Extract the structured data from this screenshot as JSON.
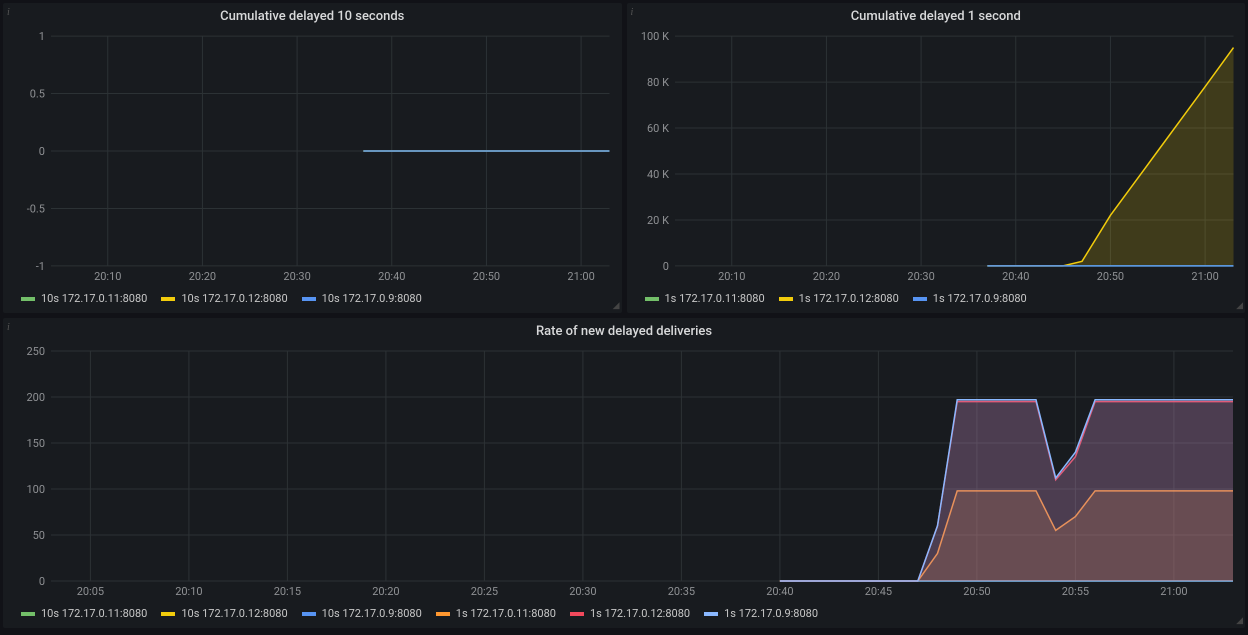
{
  "colors": {
    "green": "#73bf69",
    "yellow": "#f2cc0c",
    "cyan": "#5794f2",
    "orange": "#ff9830",
    "red": "#f2495c",
    "blue": "#8ab8ff"
  },
  "panels": {
    "p1": {
      "title": "Cumulative delayed 10 seconds",
      "legend": [
        {
          "label": "10s 172.17.0.11:8080",
          "color": "green"
        },
        {
          "label": "10s 172.17.0.12:8080",
          "color": "yellow"
        },
        {
          "label": "10s 172.17.0.9:8080",
          "color": "cyan"
        }
      ]
    },
    "p2": {
      "title": "Cumulative delayed 1 second",
      "legend": [
        {
          "label": "1s 172.17.0.11:8080",
          "color": "green"
        },
        {
          "label": "1s 172.17.0.12:8080",
          "color": "yellow"
        },
        {
          "label": "1s 172.17.0.9:8080",
          "color": "cyan"
        }
      ]
    },
    "p3": {
      "title": "Rate of new delayed deliveries",
      "legend": [
        {
          "label": "10s 172.17.0.11:8080",
          "color": "green"
        },
        {
          "label": "10s 172.17.0.12:8080",
          "color": "yellow"
        },
        {
          "label": "10s 172.17.0.9:8080",
          "color": "cyan"
        },
        {
          "label": "1s 172.17.0.11:8080",
          "color": "orange"
        },
        {
          "label": "1s 172.17.0.12:8080",
          "color": "red"
        },
        {
          "label": "1s 172.17.0.9:8080",
          "color": "blue"
        }
      ]
    }
  },
  "chart_data": [
    {
      "id": "p1",
      "type": "line",
      "title": "Cumulative delayed 10 seconds",
      "xlabel": "",
      "ylabel": "",
      "x_ticks": [
        "20:10",
        "20:20",
        "20:30",
        "20:40",
        "20:50",
        "21:00"
      ],
      "y_ticks": [
        -1.0,
        -0.5,
        0,
        0.5,
        1.0
      ],
      "xlim": [
        "20:04",
        "21:03"
      ],
      "ylim": [
        -1.0,
        1.0
      ],
      "series": [
        {
          "name": "10s 172.17.0.11:8080",
          "color": "green",
          "x": [
            "20:37",
            "21:03"
          ],
          "y": [
            0,
            0
          ]
        },
        {
          "name": "10s 172.17.0.12:8080",
          "color": "yellow",
          "x": [
            "20:37",
            "21:03"
          ],
          "y": [
            0,
            0
          ]
        },
        {
          "name": "10s 172.17.0.9:8080",
          "color": "cyan",
          "x": [
            "20:37",
            "21:03"
          ],
          "y": [
            0,
            0
          ]
        }
      ]
    },
    {
      "id": "p2",
      "type": "area",
      "title": "Cumulative delayed 1 second",
      "xlabel": "",
      "ylabel": "",
      "x_ticks": [
        "20:10",
        "20:20",
        "20:30",
        "20:40",
        "20:50",
        "21:00"
      ],
      "y_ticks_labels": [
        "0",
        "20 K",
        "40 K",
        "60 K",
        "80 K",
        "100 K"
      ],
      "y_ticks": [
        0,
        20000,
        40000,
        60000,
        80000,
        100000
      ],
      "xlim": [
        "20:04",
        "21:03"
      ],
      "ylim": [
        0,
        100000
      ],
      "series": [
        {
          "name": "1s 172.17.0.11:8080",
          "color": "green",
          "x": [
            "20:37",
            "20:45",
            "20:50",
            "20:55",
            "21:00",
            "21:03"
          ],
          "y": [
            0,
            0,
            0,
            0,
            0,
            0
          ]
        },
        {
          "name": "1s 172.17.0.12:8080",
          "color": "yellow",
          "x": [
            "20:37",
            "20:45",
            "20:47",
            "20:50",
            "20:55",
            "21:00",
            "21:03"
          ],
          "y": [
            0,
            0,
            2000,
            22000,
            50000,
            78000,
            95000
          ]
        },
        {
          "name": "1s 172.17.0.9:8080",
          "color": "cyan",
          "x": [
            "20:37",
            "20:45",
            "20:50",
            "20:55",
            "21:00",
            "21:03"
          ],
          "y": [
            0,
            0,
            0,
            0,
            0,
            0
          ]
        }
      ]
    },
    {
      "id": "p3",
      "type": "area",
      "title": "Rate of new delayed deliveries",
      "xlabel": "",
      "ylabel": "",
      "x_ticks": [
        "20:05",
        "20:10",
        "20:15",
        "20:20",
        "20:25",
        "20:30",
        "20:35",
        "20:40",
        "20:45",
        "20:50",
        "20:55",
        "21:00"
      ],
      "y_ticks": [
        0,
        50,
        100,
        150,
        200,
        250
      ],
      "xlim": [
        "20:03",
        "21:03"
      ],
      "ylim": [
        0,
        250
      ],
      "series": [
        {
          "name": "10s 172.17.0.11:8080",
          "color": "green",
          "x": [
            "20:40",
            "21:03"
          ],
          "y": [
            0,
            0
          ]
        },
        {
          "name": "10s 172.17.0.12:8080",
          "color": "yellow",
          "x": [
            "20:40",
            "21:03"
          ],
          "y": [
            0,
            0
          ]
        },
        {
          "name": "10s 172.17.0.9:8080",
          "color": "cyan",
          "x": [
            "20:40",
            "21:03"
          ],
          "y": [
            0,
            0
          ]
        },
        {
          "name": "1s 172.17.0.11:8080",
          "color": "orange",
          "x": [
            "20:40",
            "20:47",
            "20:48",
            "20:49",
            "20:53",
            "20:54",
            "20:55",
            "20:56",
            "21:03"
          ],
          "y": [
            0,
            0,
            30,
            98,
            98,
            55,
            70,
            98,
            98
          ]
        },
        {
          "name": "1s 172.17.0.12:8080",
          "color": "red",
          "x": [
            "20:40",
            "20:47",
            "20:48",
            "20:49",
            "20:53",
            "20:54",
            "20:55",
            "20:56",
            "21:03"
          ],
          "y": [
            0,
            0,
            60,
            195,
            195,
            110,
            135,
            195,
            195
          ]
        },
        {
          "name": "1s 172.17.0.9:8080",
          "color": "blue",
          "x": [
            "20:40",
            "20:47",
            "20:48",
            "20:49",
            "20:53",
            "20:54",
            "20:55",
            "20:56",
            "21:03"
          ],
          "y": [
            0,
            0,
            60,
            197,
            197,
            112,
            140,
            197,
            197
          ]
        }
      ]
    }
  ]
}
